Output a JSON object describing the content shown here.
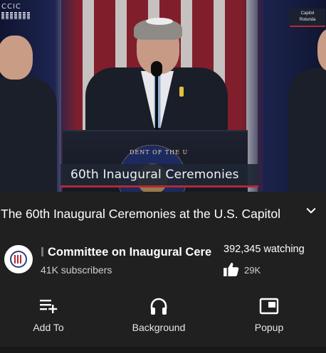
{
  "video": {
    "logo_text": "CCIC",
    "badge_line1": "Capitol",
    "badge_line2": "Rotunda",
    "lower_third": "60th Inaugural Ceremonies",
    "seal_text": "DENT OF THE U"
  },
  "info": {
    "title": "The 60th Inaugural Ceremonies at the U.S. Capitol",
    "expand_icon": "chevron-down-icon"
  },
  "channel": {
    "name": "Committee on Inaugural Ceremonies",
    "subscribers": "41K subscribers",
    "watching": "392,345 watching",
    "likes": "29K",
    "like_icon": "thumbs-up-icon"
  },
  "actions": [
    {
      "label": "Add To",
      "icon": "playlist-add-icon"
    },
    {
      "label": "Background",
      "icon": "headphones-icon"
    },
    {
      "label": "Popup",
      "icon": "popup-window-icon"
    }
  ],
  "colors": {
    "background": "#202020",
    "accent_red": "#b12a34",
    "text": "#ffffff",
    "muted_text": "#cfcfcf"
  }
}
